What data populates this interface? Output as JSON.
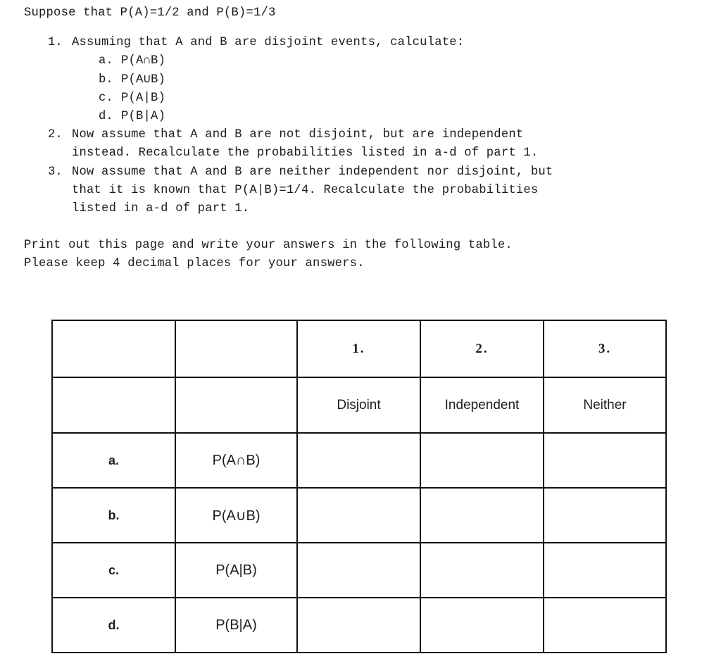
{
  "document": {
    "intro": "Suppose that P(A)=1/2 and P(B)=1/3",
    "questions": [
      {
        "marker": "1.",
        "lines": [
          "Assuming that A and B are disjoint events, calculate:"
        ],
        "subitems": [
          {
            "marker": "a.",
            "text": "P(A∩B)"
          },
          {
            "marker": "b.",
            "text": "P(A∪B)"
          },
          {
            "marker": "c.",
            "text": "P(A|B)"
          },
          {
            "marker": "d.",
            "text": "P(B|A)"
          }
        ]
      },
      {
        "marker": "2.",
        "lines": [
          "Now assume that A and B are not disjoint, but are independent",
          "instead. Recalculate the probabilities listed in a-d of part 1."
        ],
        "subitems": []
      },
      {
        "marker": "3.",
        "lines": [
          "Now assume that A and B are neither independent nor disjoint, but",
          "that it is known that P(A|B)=1/4. Recalculate the probabilities",
          "listed in a-d of part 1."
        ],
        "subitems": []
      }
    ],
    "closing": [
      "Print out this page and write your answers in the following table.",
      "Please keep 4 decimal places for your answers."
    ]
  },
  "table": {
    "header_numbers": [
      "1.",
      "2.",
      "3."
    ],
    "header_names": [
      "Disjoint",
      "Independent",
      "Neither"
    ],
    "rows": [
      {
        "letter": "a.",
        "formula": "P(A∩B)",
        "answers": [
          "",
          "",
          ""
        ]
      },
      {
        "letter": "b.",
        "formula": "P(A∪B)",
        "answers": [
          "",
          "",
          ""
        ]
      },
      {
        "letter": "c.",
        "formula": "P(A|B)",
        "answers": [
          "",
          "",
          ""
        ]
      },
      {
        "letter": "d.",
        "formula": "P(B|A)",
        "answers": [
          "",
          "",
          ""
        ]
      }
    ]
  }
}
